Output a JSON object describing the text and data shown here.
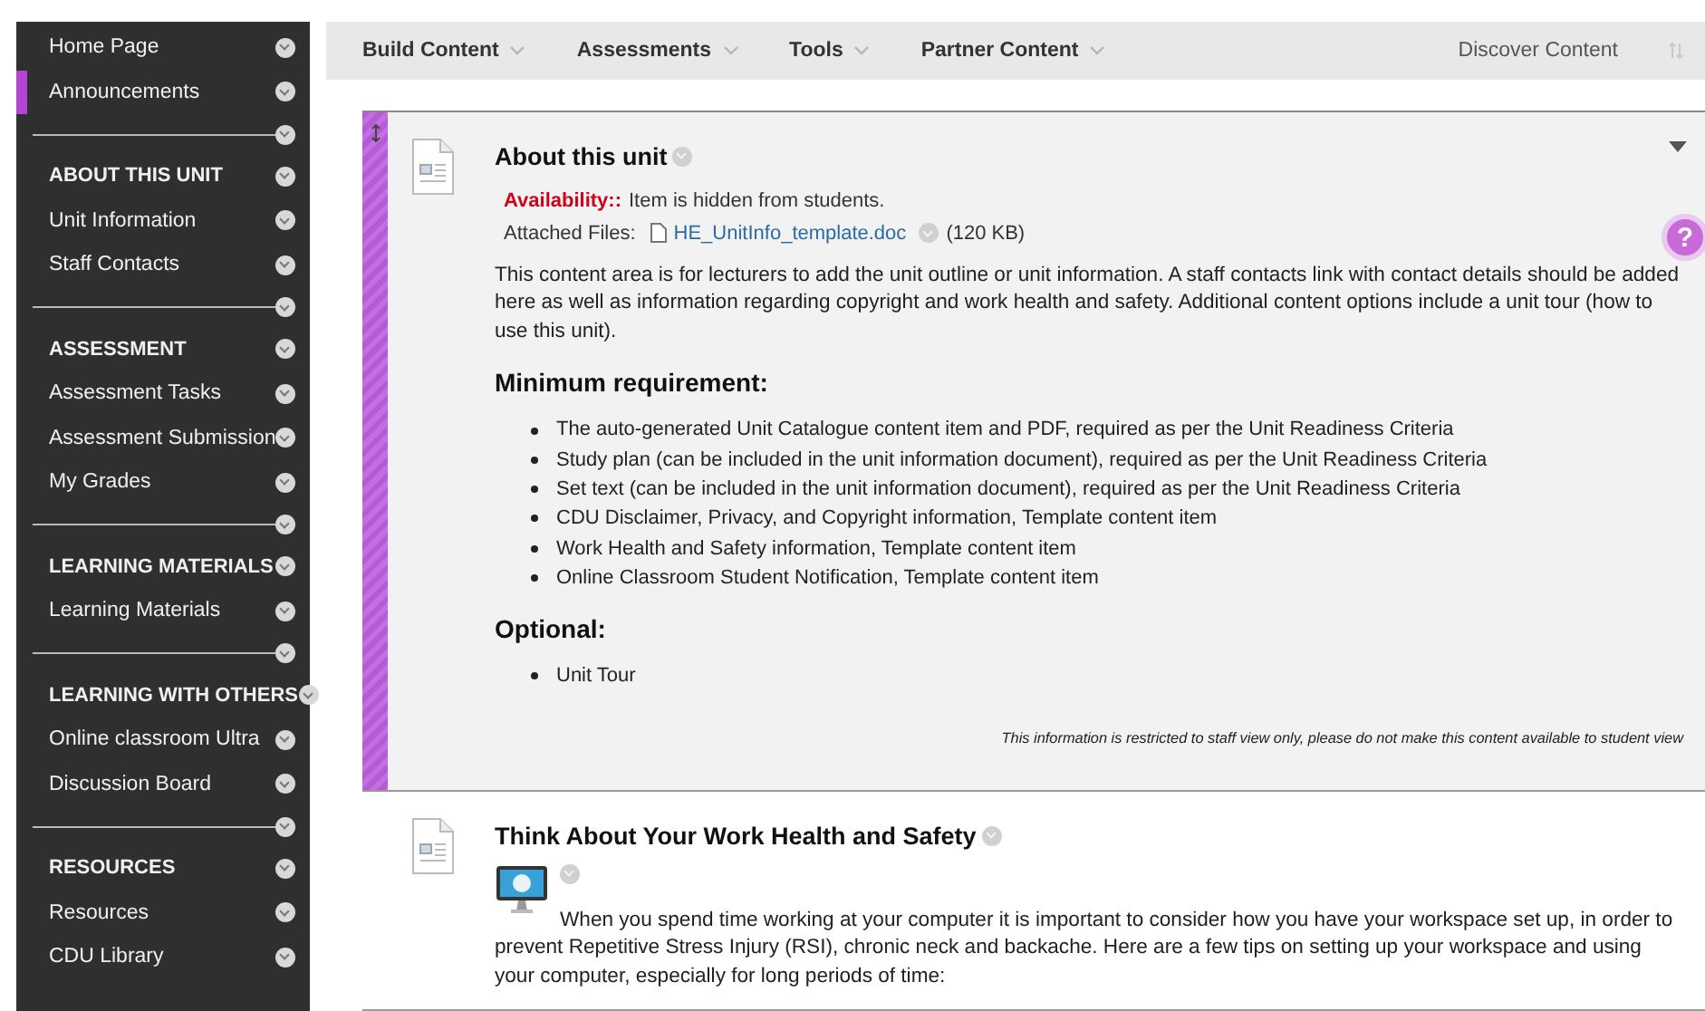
{
  "sidebar": {
    "items": [
      {
        "kind": "link",
        "label": "Home Page",
        "selected": false
      },
      {
        "kind": "link",
        "label": "Announcements",
        "selected": true
      },
      {
        "kind": "divider"
      },
      {
        "kind": "header",
        "label": "ABOUT THIS UNIT",
        "selected": false
      },
      {
        "kind": "link",
        "label": "Unit Information",
        "selected": false
      },
      {
        "kind": "link",
        "label": "Staff Contacts",
        "selected": false
      },
      {
        "kind": "divider"
      },
      {
        "kind": "header",
        "label": "ASSESSMENT",
        "selected": false
      },
      {
        "kind": "link",
        "label": "Assessment Tasks",
        "selected": false
      },
      {
        "kind": "link",
        "label": "Assessment Submission",
        "selected": false
      },
      {
        "kind": "link",
        "label": "My Grades",
        "selected": false
      },
      {
        "kind": "divider"
      },
      {
        "kind": "header",
        "label": "LEARNING MATERIALS",
        "selected": false
      },
      {
        "kind": "link",
        "label": "Learning Materials",
        "selected": false
      },
      {
        "kind": "divider"
      },
      {
        "kind": "header",
        "label": "LEARNING WITH OTHERS",
        "selected": false
      },
      {
        "kind": "link",
        "label": "Online classroom Ultra",
        "selected": false
      },
      {
        "kind": "link",
        "label": "Discussion Board",
        "selected": false
      },
      {
        "kind": "divider"
      },
      {
        "kind": "header",
        "label": "RESOURCES",
        "selected": false
      },
      {
        "kind": "link",
        "label": "Resources",
        "selected": false
      },
      {
        "kind": "link",
        "label": "CDU Library",
        "selected": false
      }
    ]
  },
  "toolbar": {
    "menus": [
      "Build Content",
      "Assessments",
      "Tools",
      "Partner Content"
    ],
    "discover": "Discover Content"
  },
  "help": "?",
  "items": [
    {
      "title": "About this unit",
      "hidden": true,
      "availability_label": "Availability::",
      "availability": "Item is hidden from students.",
      "attached_label": "Attached Files:",
      "file": "HE_UnitInfo_template.doc",
      "file_size": "(120 KB)",
      "paragraphs": [
        "This content area is for lecturers to add the unit outline or unit information. A staff contacts link with contact details should be added here as well as information regarding copyright and work health and safety. Additional content options include a unit tour (how to use this unit)."
      ],
      "sections": [
        {
          "heading": "Minimum requirement:",
          "bullets": [
            "The auto-generated Unit Catalogue content item and PDF, required as per the Unit Readiness Criteria",
            "Study plan (can be included in the unit information document), required as per the Unit Readiness Criteria",
            "Set text (can be included in the unit information document), required as per the Unit Readiness Criteria",
            "CDU Disclaimer, Privacy, and Copyright information, Template content item",
            "Work Health and Safety information, Template content item",
            "Online Classroom Student Notification, Template content item"
          ]
        },
        {
          "heading": "Optional:",
          "bullets": [
            "Unit Tour"
          ]
        }
      ],
      "note": "This information is restricted to staff view only, please do not make this content available to student view"
    },
    {
      "title": "Think About Your Work Health and Safety",
      "hidden": false,
      "image": true,
      "paragraphs": [
        "When you spend time working at your computer it is important to consider how you have your workspace set up, in order to prevent Repetitive Stress Injury (RSI), chronic neck and backache. Here are a few tips on setting up your workspace and using your computer, especially for long periods of time:"
      ]
    }
  ]
}
